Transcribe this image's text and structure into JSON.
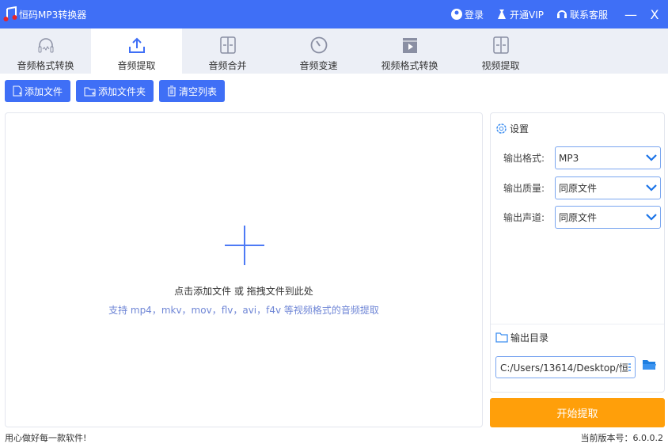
{
  "app": {
    "title": "恒码MP3转换器",
    "accent": "#3f6ff6",
    "start_color": "#ff9f0a"
  },
  "titlebar": {
    "login": "登录",
    "vip": "开通VIP",
    "support": "联系客服",
    "minimize": "—",
    "close": "X"
  },
  "tabs": [
    {
      "label": "音频格式转换",
      "icon": "headphones-icon"
    },
    {
      "label": "音频提取",
      "icon": "upload-icon",
      "active": true
    },
    {
      "label": "音频合并",
      "icon": "merge-icon"
    },
    {
      "label": "音频变速",
      "icon": "speed-dial-icon"
    },
    {
      "label": "视频格式转换",
      "icon": "video-film-icon"
    },
    {
      "label": "视频提取",
      "icon": "merge-icon"
    }
  ],
  "toolbar": {
    "add_file": "添加文件",
    "add_folder": "添加文件夹",
    "clear_list": "清空列表"
  },
  "drop": {
    "hint": "点击添加文件 或 拖拽文件到此处",
    "formats": "支持 mp4，mkv，mov，flv，avi，f4v 等视频格式的音频提取"
  },
  "settings": {
    "title": "设置",
    "format_label": "输出格式:",
    "format_value": "MP3",
    "quality_label": "输出质量:",
    "quality_value": "同原文件",
    "channel_label": "输出声道:",
    "channel_value": "同原文件"
  },
  "output": {
    "title": "输出目录",
    "path": "C:/Users/13614/Desktop/恒"
  },
  "start_label": "开始提取",
  "footer": {
    "slogan": "用心做好每一款软件!",
    "version": "当前版本号：6.0.0.2"
  }
}
